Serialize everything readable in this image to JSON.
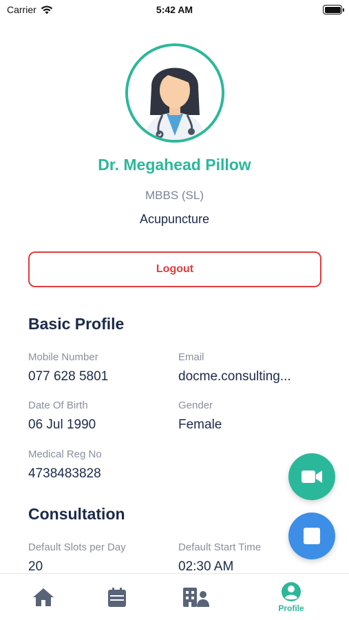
{
  "status_bar": {
    "carrier": "Carrier",
    "time": "5:42 AM"
  },
  "profile": {
    "name": "Dr. Megahead Pillow",
    "qualification": "MBBS (SL)",
    "specialty": "Acupuncture",
    "logout_label": "Logout"
  },
  "basic_profile": {
    "title": "Basic Profile",
    "mobile_label": "Mobile Number",
    "mobile_value": "077 628 5801",
    "email_label": "Email",
    "email_value": "docme.consulting...",
    "dob_label": "Date Of Birth",
    "dob_value": "06 Jul 1990",
    "gender_label": "Gender",
    "gender_value": "Female",
    "reg_label": "Medical Reg No",
    "reg_value": "4738483828"
  },
  "consultation": {
    "title": "Consultation",
    "slots_label": "Default Slots per Day",
    "slots_value": "20",
    "start_label": "Default Start Time",
    "start_value": "02:30 AM"
  },
  "tabs": [
    {
      "icon": "home-icon"
    },
    {
      "icon": "calendar-icon"
    },
    {
      "icon": "hospital-icon"
    },
    {
      "icon": "profile-icon",
      "label": "Profile",
      "active": true
    }
  ],
  "colors": {
    "accent": "#2bb89a",
    "danger": "#e23b3b",
    "blue": "#3d8ee6",
    "text": "#1c2a4a",
    "muted": "#8a8f9c",
    "inactive_icon": "#5a6478"
  }
}
